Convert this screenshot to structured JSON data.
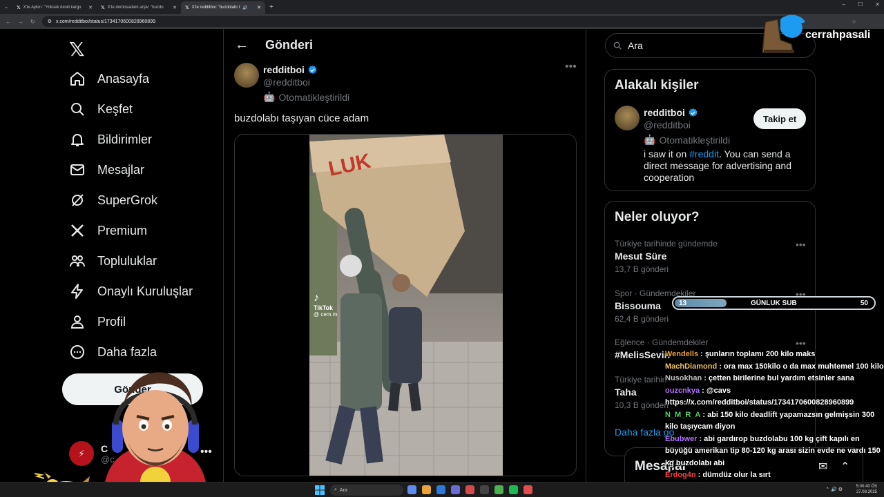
{
  "browser": {
    "tabs": [
      {
        "title": "X'te Aykırı: \"Yüksek desili kargo"
      },
      {
        "title": "X'te doritosadam arşiv: \"buzdo"
      },
      {
        "title": "X'te redditboi: \"buzdolabı t"
      }
    ],
    "url": "x.com/redditboi/status/1734170600828960899"
  },
  "sidebar": {
    "nav": [
      {
        "label": "Anasayfa",
        "icon": "home-icon"
      },
      {
        "label": "Keşfet",
        "icon": "search-icon"
      },
      {
        "label": "Bildirimler",
        "icon": "bell-icon"
      },
      {
        "label": "Mesajlar",
        "icon": "mail-icon"
      },
      {
        "label": "SuperGrok",
        "icon": "grok-icon"
      },
      {
        "label": "Premium",
        "icon": "x-icon"
      },
      {
        "label": "Topluluklar",
        "icon": "community-icon"
      },
      {
        "label": "Onaylı Kuruluşlar",
        "icon": "lightning-icon"
      },
      {
        "label": "Profil",
        "icon": "person-icon"
      },
      {
        "label": "Daha fazla",
        "icon": "more-circle-icon"
      }
    ],
    "post_button": "Gönder",
    "account": {
      "name": "C",
      "handle": "@c"
    }
  },
  "main": {
    "header_title": "Gönderi",
    "post": {
      "author": "redditboi",
      "handle": "@redditboi",
      "automated": "Otomatikleştirildi",
      "text": "buzdolabı taşıyan cüce adam",
      "watermark_brand": "TikTok",
      "watermark_handle": "@ cem.m"
    }
  },
  "right": {
    "search_placeholder": "Ara",
    "relevant": {
      "title": "Alakalı kişiler",
      "name": "redditboi",
      "handle": "@redditboi",
      "automated": "Otomatikleştirildi",
      "bio_before": "i saw it on ",
      "bio_tag": "#reddit",
      "bio_after": ". You can send a direct message for advertising and cooperation",
      "follow": "Takip et"
    },
    "trends": {
      "title": "Neler oluyor?",
      "items": [
        {
          "context": "Türkiye tarihinde gündemde",
          "topic": "Mesut Süre",
          "count": "13,7 B gönderi"
        },
        {
          "context": "Spor · Gündemdekiler",
          "topic": "Bissouma",
          "count": "62,4 B gönderi"
        },
        {
          "context": "Eğlence · Gündemdekiler",
          "topic": "#MelisSevin",
          "count": ""
        },
        {
          "context": "Türkiye tarihin",
          "topic": "Taha",
          "count": "10,3 B gönderi"
        }
      ],
      "show_more": "Daha fazla gö"
    },
    "messages": "Mesajlar"
  },
  "overlay": {
    "channel": "cerrahpasali",
    "sub_goal": {
      "current": "13",
      "label": "GÜNLUK SUB",
      "target": "50",
      "fraction": 0.26
    },
    "chat": [
      {
        "user": "Wendells",
        "color": "#f0a030",
        "text": ": şunların toplamı 200 kilo maks"
      },
      {
        "user": "MachDiamond",
        "color": "#f0c060",
        "text": ": ora max 150kilo o da max muhtemel 100 kilo"
      },
      {
        "user": "Nusokhan",
        "color": "#c0c0c0",
        "text": ": çetten birilerine bul yardım etsinler sana"
      },
      {
        "user": "ouzcnkya",
        "color": "#b070ff",
        "text": ": @cavs https://x.com/redditboi/status/1734170600828960899"
      },
      {
        "user": "N_M_R_A",
        "color": "#4fd06a",
        "text": ": abi 150 kilo deadlift yapamazsın gelmişsin 300 kilo taşıycam diyon"
      },
      {
        "user": "Ebubwer",
        "color": "#b070ff",
        "text": ": abi gardırop buzdolabu 100 kg çift kapılı en büyüğü amerikan tip 80-120 kg arası sizin evde ne vardı 150 kg buzdolabı abi"
      },
      {
        "user": "Erdog4n",
        "color": "#ff4040",
        "text": ": dümdüz olur la sırt"
      }
    ]
  },
  "taskbar": {
    "search": "Ara",
    "time": "5:00:40 ÖS",
    "date": "27.08.2025"
  },
  "colors": {
    "accent": "#1d9bf0",
    "background": "#000000",
    "border": "#2f3336"
  }
}
